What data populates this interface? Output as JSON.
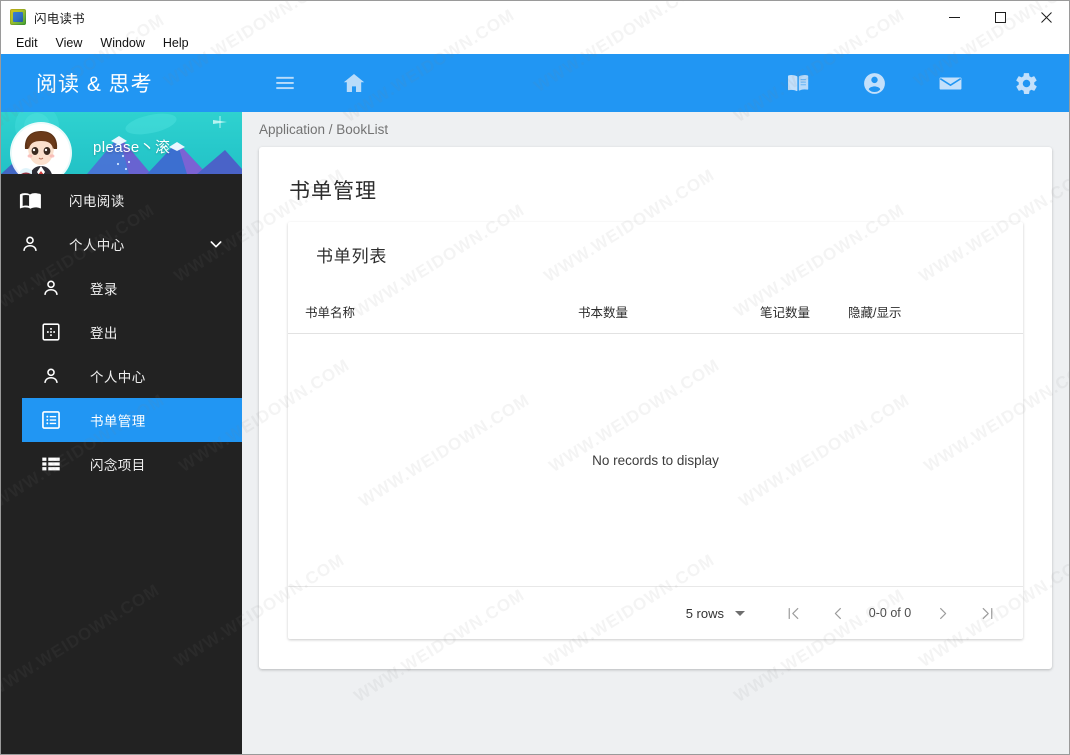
{
  "window": {
    "title": "闪电读书",
    "app_icon": "app-icon",
    "controls": {
      "minimize": "minimize-icon",
      "maximize": "maximize-icon",
      "close": "close-icon"
    },
    "menu": [
      "Edit",
      "View",
      "Window",
      "Help"
    ]
  },
  "sidebar": {
    "brand": "阅读 & 思考",
    "profile": {
      "username": "please丶滚"
    },
    "items": [
      {
        "label": "闪电阅读",
        "icon": "book-open-icon",
        "level": 1,
        "active": false,
        "chevron": false
      },
      {
        "label": "个人中心",
        "icon": "person-icon",
        "level": 1,
        "active": false,
        "chevron": true
      },
      {
        "label": "登录",
        "icon": "person-icon",
        "level": 2,
        "active": false,
        "chevron": false
      },
      {
        "label": "登出",
        "icon": "exit-box-icon",
        "level": 2,
        "active": false,
        "chevron": false
      },
      {
        "label": "个人中心",
        "icon": "person-icon",
        "level": 2,
        "active": false,
        "chevron": false
      },
      {
        "label": "书单管理",
        "icon": "list-box-icon",
        "level": 2,
        "active": true,
        "chevron": false
      },
      {
        "label": "闪念项目",
        "icon": "list-icon",
        "level": 2,
        "active": false,
        "chevron": false
      }
    ]
  },
  "topbar": {
    "menu_icon": "hamburger-icon",
    "home_icon": "home-icon",
    "right_icons": [
      "book-icon",
      "account-circle-icon",
      "email-icon",
      "settings-gear-icon"
    ]
  },
  "breadcrumb": "Application / BookList",
  "main": {
    "page_title": "书单管理",
    "table_card_title": "书单列表",
    "columns": [
      "书单名称",
      "书本数量",
      "笔记数量",
      "隐藏/显示"
    ],
    "rows": [],
    "empty_message": "No records to display",
    "pagination": {
      "rows_per_page": "5 rows",
      "range": "0-0 of 0",
      "first_icon": "first-page-icon",
      "prev_icon": "prev-page-icon",
      "next_icon": "next-page-icon",
      "last_icon": "last-page-icon"
    }
  },
  "colors": {
    "accent": "#2196f3",
    "sidebar_bg": "#222222",
    "profile_banner": "#2ccccb",
    "page_bg": "#eef0f2"
  },
  "watermark": "WWW.WEIDOWN.COM"
}
